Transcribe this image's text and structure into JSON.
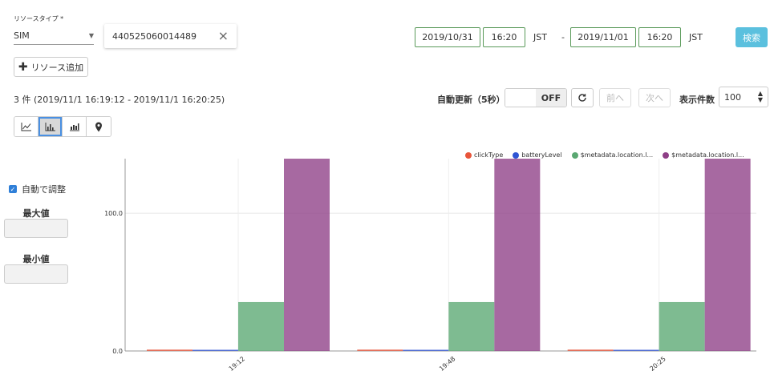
{
  "resource": {
    "type_label": "リソースタイプ *",
    "type_value": "SIM",
    "id_value": "440525060014489",
    "add_label": "リソース追加"
  },
  "period": {
    "start_date": "2019/10/31",
    "start_time": "16:20",
    "start_tz": "JST",
    "separator": "-",
    "end_date": "2019/11/01",
    "end_time": "16:20",
    "end_tz": "JST",
    "search_label": "検索"
  },
  "results": {
    "summary": "3 件 (2019/11/1 16:19:12 - 2019/11/1 16:20:25)",
    "auto_refresh_label": "自動更新（5秒）",
    "auto_refresh_state": "OFF",
    "prev_label": "前へ",
    "next_label": "次へ",
    "page_size_label": "表示件数",
    "page_size_value": "100"
  },
  "side": {
    "auto_adjust_label": "自動で調整",
    "max_label": "最大値",
    "min_label": "最小値"
  },
  "chart_data": {
    "type": "bar",
    "categories": [
      "19:12",
      "19:48",
      "20:25"
    ],
    "series": [
      {
        "name": "clickType",
        "color": "#e8553a",
        "values": [
          1,
          1,
          1
        ]
      },
      {
        "name": "batteryLevel",
        "color": "#2f55d4",
        "values": [
          0.75,
          0.75,
          0.75
        ]
      },
      {
        "name": "$metadata.location.l...",
        "color": "#5aa872",
        "values": [
          35.5,
          35.5,
          35.5
        ]
      },
      {
        "name": "$metadata.location.l...",
        "color": "#8e3f86",
        "values": [
          139.6,
          139.6,
          139.6
        ]
      }
    ],
    "yticks": [
      "0.0",
      "100.0"
    ],
    "ylim": [
      0,
      139.6
    ],
    "grid": true,
    "legend": "top-right"
  },
  "colors": {
    "accent": "#5bc0de",
    "date_border": "#5a9a5a"
  }
}
